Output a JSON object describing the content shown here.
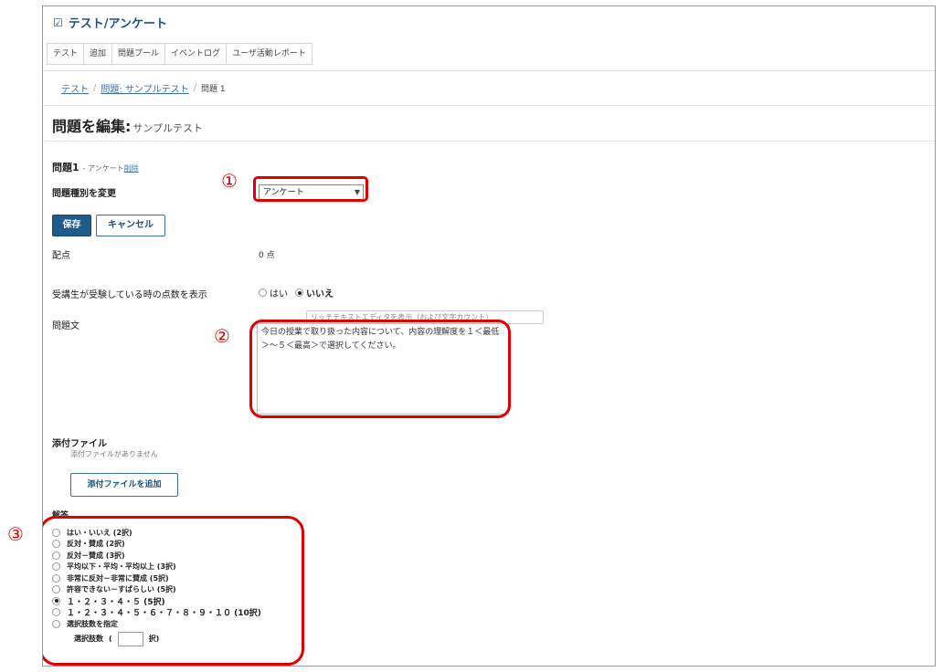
{
  "tool_title": "テスト/アンケート",
  "tabs": [
    "テスト",
    "追加",
    "問題プール",
    "イベントログ",
    "ユーザ活動レポート"
  ],
  "breadcrumb": {
    "link1": "テスト",
    "link2": "問題: サンプルテスト",
    "current": "問題 1"
  },
  "page": {
    "title": "問題を編集:",
    "subtitle": "サンプルテスト"
  },
  "question": {
    "heading": "問題1",
    "type_meta": "- アンケート",
    "delete_label": "削除",
    "change_type_label": "問題種別を変更",
    "type_value": "アンケート"
  },
  "buttons": {
    "save": "保存",
    "cancel": "キャンセル",
    "attach": "添付ファイルを追加"
  },
  "points": {
    "label": "配点",
    "value": "0 点"
  },
  "show_score": {
    "label": "受講生が受験している時の点数を表示",
    "yes": "はい",
    "no": "いいえ"
  },
  "question_text": {
    "label": "問題文",
    "rte_link": "リッチテキストエディタを表示（および文字カウント）",
    "value": "今日の授業で取り扱った内容について、内容の理解度を１＜最低＞～５＜最高＞で選択してください。"
  },
  "attachments": {
    "label": "添付ファイル",
    "empty": "添付ファイルがありません"
  },
  "answers": {
    "label": "解答",
    "options": [
      {
        "text": "はい・いいえ (2択)",
        "selected": false
      },
      {
        "text": "反対・賛成 (2択)",
        "selected": false
      },
      {
        "text": "反対－賛成 (3択)",
        "selected": false
      },
      {
        "text": "平均以下・平均・平均以上 (3択)",
        "selected": false
      },
      {
        "text": "非常に反対－非常に賛成 (5択)",
        "selected": false
      },
      {
        "text": "許容できない－すばらしい (5択)",
        "selected": false
      },
      {
        "text": "１・２・３・４・５ (5択)",
        "selected": true
      },
      {
        "text": "１・２・３・４・５・６・７・８・９・１０ (10択)",
        "selected": false
      },
      {
        "text": "選択肢数を指定",
        "selected": false
      }
    ],
    "count_label": "選択肢数",
    "count_paren": "(",
    "count_unit": "択)"
  },
  "markers": [
    "①",
    "②",
    "③"
  ],
  "colors": {
    "accent": "#1f5a8a",
    "callout": "#e00000"
  }
}
